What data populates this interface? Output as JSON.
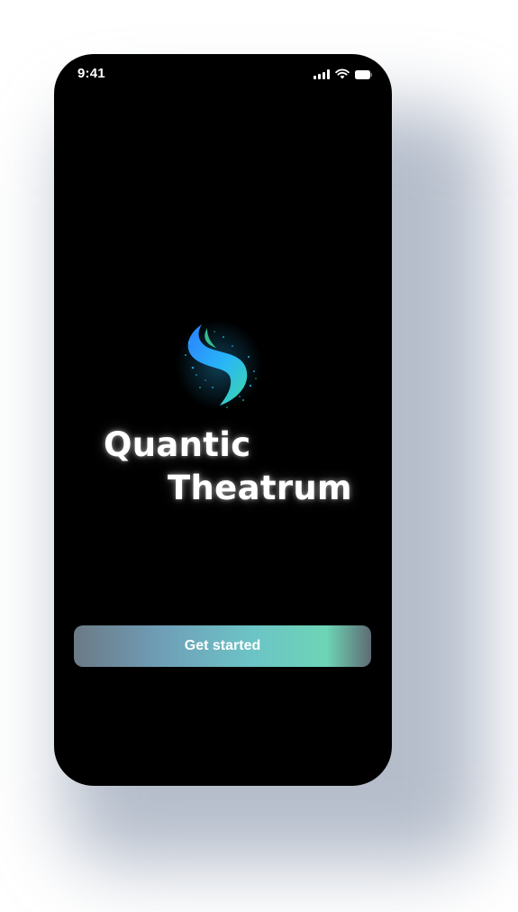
{
  "status_bar": {
    "time": "9:41",
    "icons": [
      "signal-icon",
      "wifi-icon",
      "battery-icon"
    ]
  },
  "brand": {
    "logo_icon": "wave-particle-logo",
    "title_line_1": "Quantic",
    "title_line_2": "Theatrum"
  },
  "actions": {
    "get_started_label": "Get started"
  },
  "colors": {
    "screen_background": "#000000",
    "button_gradient": [
      "#6b7a86",
      "#6f9fb8",
      "#6cc4c6",
      "#6dd5b5",
      "#5e6b74"
    ],
    "logo_gradient": [
      "#2a7fff",
      "#29b6f6",
      "#3dd9a8"
    ]
  }
}
